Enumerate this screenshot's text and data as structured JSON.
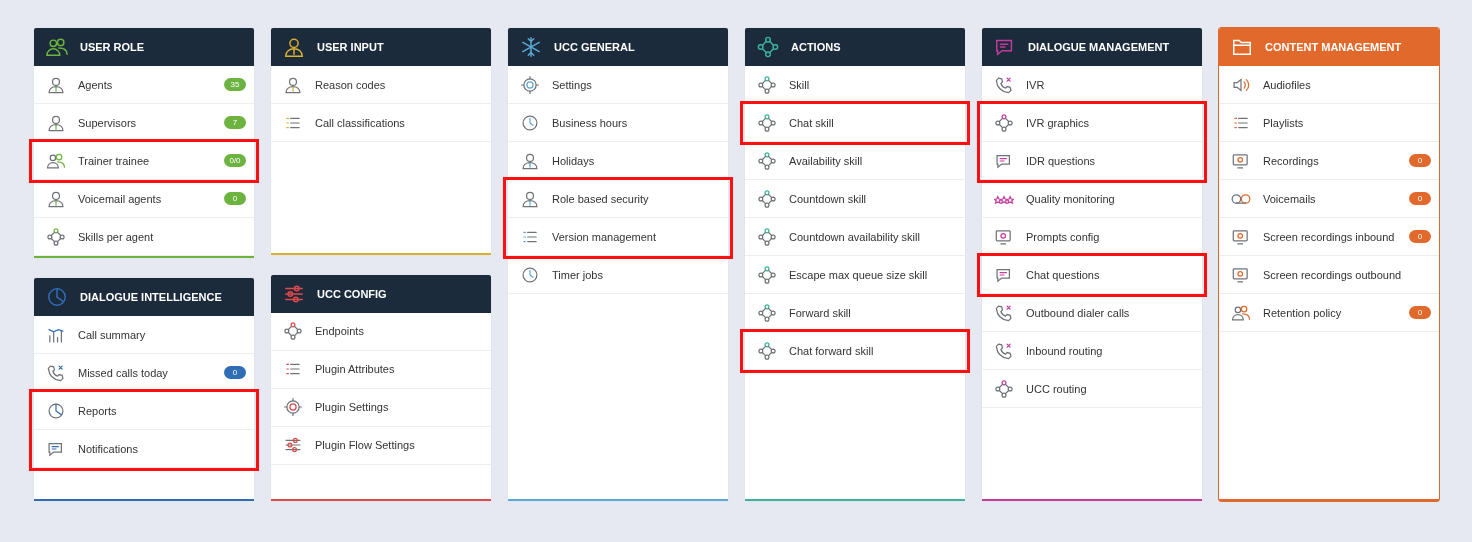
{
  "columns": [
    {
      "cards": [
        {
          "title": "USER ROLE",
          "kind": "dark",
          "color": "#6cb33f",
          "items": [
            {
              "label": "Agents",
              "badge": {
                "text": "35",
                "color": "#6cb33f"
              },
              "highlighted": false
            },
            {
              "label": "Supervisors",
              "badge": {
                "text": "7",
                "color": "#6cb33f"
              },
              "highlighted": false
            },
            {
              "label": "Trainer trainee",
              "badge": {
                "text": "0/0",
                "color": "#6cb33f"
              },
              "highlighted": true
            },
            {
              "label": "Voicemail agents",
              "badge": {
                "text": "0",
                "color": "#6cb33f"
              },
              "highlighted": false
            },
            {
              "label": "Skills per agent",
              "highlighted": false
            }
          ]
        },
        {
          "title": "DIALOGUE INTELLIGENCE",
          "kind": "dark",
          "color": "#2f6db5",
          "items": [
            {
              "label": "Call summary",
              "highlighted": false
            },
            {
              "label": "Missed calls today",
              "badge": {
                "text": "0",
                "color": "#2f6db5"
              },
              "highlighted": false
            },
            {
              "label": "Reports",
              "highlighted": true
            },
            {
              "label": "Notifications",
              "highlighted": true
            }
          ]
        }
      ]
    },
    {
      "cards": [
        {
          "title": "USER INPUT",
          "kind": "dark",
          "color": "#d9b030",
          "items": [
            {
              "label": "Reason codes",
              "highlighted": false
            },
            {
              "label": "Call classifications",
              "highlighted": false
            }
          ]
        },
        {
          "title": "UCC CONFIG",
          "kind": "dark",
          "color": "#e0484a",
          "items": [
            {
              "label": "Endpoints",
              "highlighted": false
            },
            {
              "label": "Plugin Attributes",
              "highlighted": false
            },
            {
              "label": "Plugin Settings",
              "highlighted": false
            },
            {
              "label": "Plugin Flow Settings",
              "highlighted": false
            }
          ]
        }
      ]
    },
    {
      "cards": [
        {
          "title": "UCC GENERAL",
          "kind": "dark",
          "color": "#5aa9d6",
          "items": [
            {
              "label": "Settings",
              "highlighted": false
            },
            {
              "label": "Business hours",
              "highlighted": false
            },
            {
              "label": "Holidays",
              "highlighted": false
            },
            {
              "label": "Role based security",
              "highlighted": true
            },
            {
              "label": "Version management",
              "highlighted": true
            },
            {
              "label": "Timer jobs",
              "highlighted": false
            }
          ]
        }
      ]
    },
    {
      "cards": [
        {
          "title": "ACTIONS",
          "kind": "dark",
          "color": "#3bb39a",
          "items": [
            {
              "label": "Skill",
              "highlighted": false
            },
            {
              "label": "Chat skill",
              "highlighted": true
            },
            {
              "label": "Availability skill",
              "highlighted": false
            },
            {
              "label": "Countdown skill",
              "highlighted": false
            },
            {
              "label": "Countdown availability skill",
              "highlighted": false
            },
            {
              "label": "Escape max queue size skill",
              "highlighted": false
            },
            {
              "label": "Forward skill",
              "highlighted": false
            },
            {
              "label": "Chat forward skill",
              "highlighted": true
            }
          ]
        }
      ]
    },
    {
      "cards": [
        {
          "title": "DIALOGUE MANAGEMENT",
          "kind": "dark",
          "color": "#c63a9c",
          "items": [
            {
              "label": "IVR",
              "highlighted": false
            },
            {
              "label": "IVR graphics",
              "highlighted": true
            },
            {
              "label": "IDR questions",
              "highlighted": true
            },
            {
              "label": "Quality monitoring",
              "highlighted": false
            },
            {
              "label": "Prompts config",
              "highlighted": false
            },
            {
              "label": "Chat questions",
              "highlighted": true
            },
            {
              "label": "Outbound dialer calls",
              "highlighted": false
            },
            {
              "label": "Inbound routing",
              "highlighted": false
            },
            {
              "label": "UCC routing",
              "highlighted": false
            }
          ]
        }
      ]
    },
    {
      "cards": [
        {
          "title": "CONTENT MANAGEMENT",
          "kind": "filled",
          "color": "#e0692b",
          "items": [
            {
              "label": "Audiofiles",
              "highlighted": false
            },
            {
              "label": "Playlists",
              "highlighted": false
            },
            {
              "label": "Recordings",
              "badge": {
                "text": "0",
                "color": "#e0692b"
              },
              "highlighted": false
            },
            {
              "label": "Voicemails",
              "badge": {
                "text": "0",
                "color": "#e0692b"
              },
              "highlighted": false
            },
            {
              "label": "Screen recordings inbound",
              "badge": {
                "text": "0",
                "color": "#e0692b"
              },
              "highlighted": false
            },
            {
              "label": "Screen recordings outbound",
              "highlighted": false
            },
            {
              "label": "Retention policy",
              "badge": {
                "text": "0",
                "color": "#e0692b"
              },
              "highlighted": false
            }
          ]
        }
      ]
    }
  ]
}
